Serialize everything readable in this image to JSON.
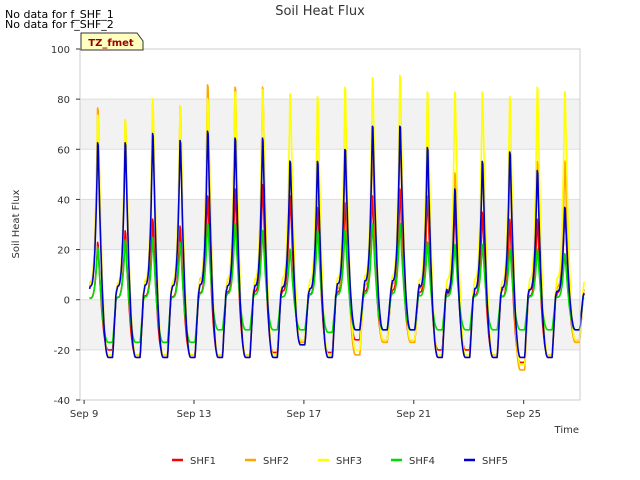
{
  "notes": [
    "No data for f_SHF_1",
    "No data for f_SHF_2"
  ],
  "chart_data": {
    "type": "line",
    "title": "Soil Heat Flux",
    "xlabel": "Time",
    "ylabel": "Soil Heat Flux",
    "badge": "TZ_fmet",
    "ylim": [
      -40,
      100
    ],
    "xlim_days": [
      "Sep 9",
      "Sep 27"
    ],
    "yticks": [
      -40,
      -20,
      0,
      20,
      40,
      60,
      80,
      100
    ],
    "xticks": [
      {
        "label": "Sep 9",
        "day": 9
      },
      {
        "label": "Sep 13",
        "day": 13
      },
      {
        "label": "Sep 17",
        "day": 17
      },
      {
        "label": "Sep 21",
        "day": 21
      },
      {
        "label": "Sep 25",
        "day": 25
      }
    ],
    "grid": "horizontal bands",
    "legend_position": "bottom",
    "day_start": 9.2,
    "series": [
      {
        "name": "SHF1",
        "color": "#ff0000",
        "peaks": [
          25,
          30,
          35,
          32,
          45,
          48,
          50,
          45,
          40,
          42,
          45,
          48,
          45,
          40,
          38,
          35,
          35,
          40
        ],
        "troughs": [
          -20,
          -22,
          -22,
          -22,
          -22,
          -22,
          -21,
          -16,
          -21,
          -16,
          -16,
          -16,
          -20,
          -20,
          -22,
          -25,
          -22,
          -16
        ]
      },
      {
        "name": "SHF2",
        "color": "#ffa500",
        "peaks": [
          83,
          78,
          84,
          84,
          93,
          92,
          92,
          60,
          60,
          60,
          65,
          70,
          60,
          55,
          60,
          60,
          60,
          60
        ],
        "troughs": [
          -23,
          -23,
          -23,
          -23,
          -23,
          -23,
          -23,
          -17,
          -23,
          -22,
          -17,
          -17,
          -23,
          -23,
          -23,
          -28,
          -23,
          -17
        ]
      },
      {
        "name": "SHF3",
        "color": "#ffff00",
        "peaks": [
          80,
          78,
          87,
          84,
          87,
          90,
          91,
          89,
          88,
          92,
          96,
          97,
          90,
          90,
          90,
          88,
          92,
          90
        ],
        "troughs": [
          -22,
          -22,
          -22,
          -22,
          -22,
          -22,
          -22,
          -16,
          -22,
          -20,
          -16,
          -16,
          -22,
          -22,
          -22,
          -26,
          -22,
          -16
        ]
      },
      {
        "name": "SHF4",
        "color": "#00dd00",
        "peaks": [
          23,
          26,
          27,
          25,
          33,
          33,
          30,
          22,
          30,
          30,
          33,
          33,
          25,
          24,
          24,
          22,
          22,
          20
        ],
        "troughs": [
          -17,
          -17,
          -17,
          -17,
          -12,
          -12,
          -12,
          -12,
          -13,
          -12,
          -12,
          -12,
          -12,
          -12,
          -12,
          -12,
          -12,
          -12
        ]
      },
      {
        "name": "SHF5",
        "color": "#0000cc",
        "peaks": [
          68,
          68,
          72,
          69,
          73,
          70,
          70,
          60,
          60,
          65,
          75,
          75,
          66,
          48,
          60,
          64,
          56,
          40
        ],
        "troughs": [
          -23,
          -23,
          -23,
          -23,
          -23,
          -23,
          -23,
          -18,
          -23,
          -12,
          -12,
          -12,
          -23,
          -23,
          -23,
          -23,
          -23,
          -12
        ]
      }
    ]
  }
}
